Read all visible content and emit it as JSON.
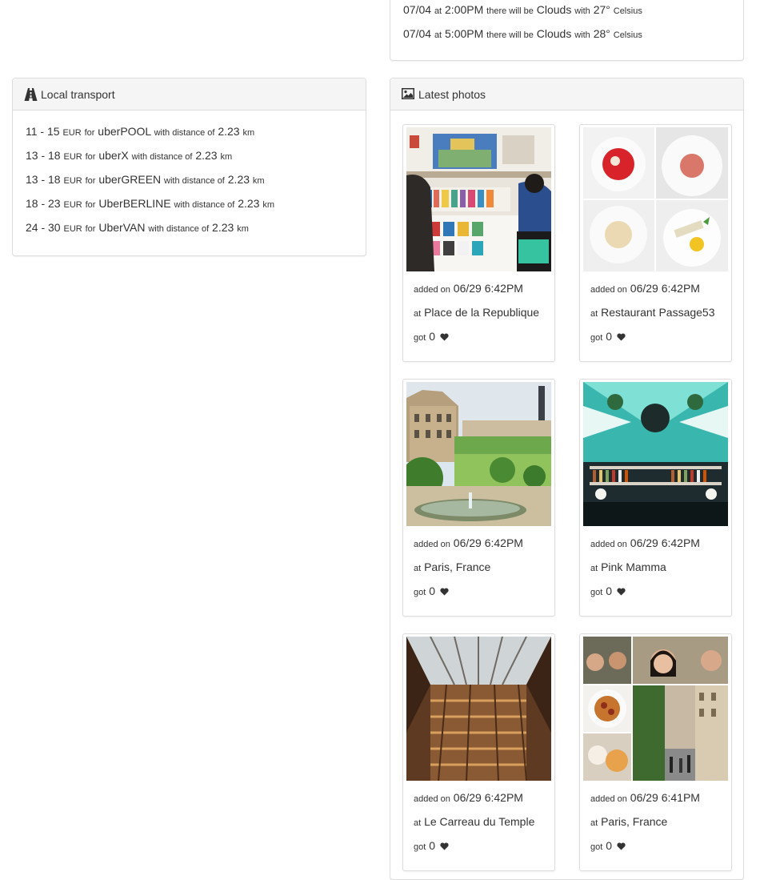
{
  "weather": {
    "rows": [
      {
        "date": "07/04",
        "at": "at",
        "time": "2:00PM",
        "will_be": "there will be",
        "condition": "Clouds",
        "with": "with",
        "temp": "27°",
        "unit": "Celsius"
      },
      {
        "date": "07/04",
        "at": "at",
        "time": "5:00PM",
        "will_be": "there will be",
        "condition": "Clouds",
        "with": "with",
        "temp": "28°",
        "unit": "Celsius"
      }
    ]
  },
  "transport": {
    "title": "Local transport",
    "icon": "road-icon",
    "rows": [
      {
        "range": "11 - 15",
        "currency": "EUR",
        "for": "for",
        "product": "uberPOOL",
        "distance_label": "with distance of",
        "distance": "2.23",
        "unit": "km"
      },
      {
        "range": "13 - 18",
        "currency": "EUR",
        "for": "for",
        "product": "uberX",
        "distance_label": "with distance of",
        "distance": "2.23",
        "unit": "km"
      },
      {
        "range": "13 - 18",
        "currency": "EUR",
        "for": "for",
        "product": "uberGREEN",
        "distance_label": "with distance of",
        "distance": "2.23",
        "unit": "km"
      },
      {
        "range": "18 - 23",
        "currency": "EUR",
        "for": "for",
        "product": "UberBERLINE",
        "distance_label": "with distance of",
        "distance": "2.23",
        "unit": "km"
      },
      {
        "range": "24 - 30",
        "currency": "EUR",
        "for": "for",
        "product": "UberVAN",
        "distance_label": "with distance of",
        "distance": "2.23",
        "unit": "km"
      }
    ]
  },
  "photos": {
    "title": "Latest photos",
    "icon": "picture-icon",
    "items": [
      {
        "added_label": "added on",
        "date": "06/29 6:42PM",
        "at_label": "at",
        "place": "Place de la Republique",
        "got_label": "got",
        "likes": "0",
        "image": "bookshop"
      },
      {
        "added_label": "added on",
        "date": "06/29 6:42PM",
        "at_label": "at",
        "place": "Restaurant Passage53",
        "got_label": "got",
        "likes": "0",
        "image": "dishes-collage"
      },
      {
        "added_label": "added on",
        "date": "06/29 6:42PM",
        "at_label": "at",
        "place": "Paris, France",
        "got_label": "got",
        "likes": "0",
        "image": "tuileries-garden"
      },
      {
        "added_label": "added on",
        "date": "06/29 6:42PM",
        "at_label": "at",
        "place": "Pink Mamma",
        "got_label": "got",
        "likes": "0",
        "image": "bar-interior"
      },
      {
        "added_label": "added on",
        "date": "06/29 6:42PM",
        "at_label": "at",
        "place": "Le Carreau du Temple",
        "got_label": "got",
        "likes": "0",
        "image": "glass-roof"
      },
      {
        "added_label": "added on",
        "date": "06/29 6:41PM",
        "at_label": "at",
        "place": "Paris, France",
        "got_label": "got",
        "likes": "0",
        "image": "paris-collage"
      }
    ]
  },
  "colors": {
    "panel_border": "#dddddd",
    "heading_bg": "#f5f5f5",
    "text": "#333333"
  }
}
